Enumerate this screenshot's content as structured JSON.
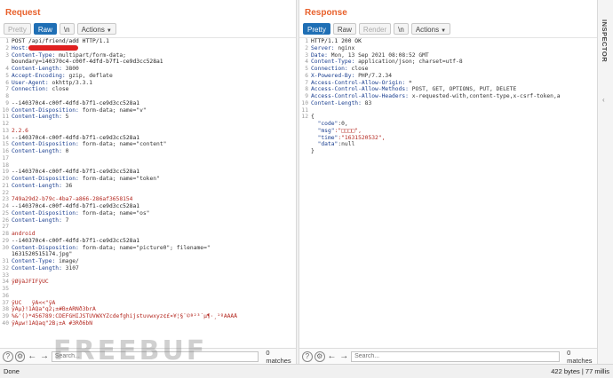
{
  "request": {
    "title": "Request",
    "tabs": [
      {
        "label": "Pretty",
        "state": "disabled"
      },
      {
        "label": "Raw",
        "state": "active"
      },
      {
        "label": "\\n",
        "state": "normal"
      },
      {
        "label": "Actions",
        "state": "normal"
      }
    ],
    "lines": [
      {
        "n": "1",
        "k": "",
        "v": "POST /api/friend/add HTTP/1.1",
        "style": "plain"
      },
      {
        "n": "2",
        "k": "Host:",
        "v": "",
        "style": "redact"
      },
      {
        "n": "3",
        "k": "Content-Type:",
        "v": " multipart/form-data;",
        "style": "kv"
      },
      {
        "n": "",
        "k": "",
        "v": "boundary=i40370c4-c00f-4dfd-b7f1-ce9d3cc528a1",
        "style": "plain"
      },
      {
        "n": "4",
        "k": "Content-Length:",
        "v": " 3800",
        "style": "kv"
      },
      {
        "n": "5",
        "k": "Accept-Encoding:",
        "v": " gzip, deflate",
        "style": "kv"
      },
      {
        "n": "6",
        "k": "User-Agent:",
        "v": " okhttp/3.3.1",
        "style": "kv"
      },
      {
        "n": "7",
        "k": "Connection:",
        "v": " close",
        "style": "kv"
      },
      {
        "n": "8",
        "k": "",
        "v": "",
        "style": "plain"
      },
      {
        "n": "9",
        "k": "",
        "v": "--i40370c4-c00f-4dfd-b7f1-ce9d3cc528a1",
        "style": "plain"
      },
      {
        "n": "10",
        "k": "Content-Disposition:",
        "v": " form-data; name=\"v\"",
        "style": "kv"
      },
      {
        "n": "11",
        "k": "Content-Length:",
        "v": " 5",
        "style": "kv"
      },
      {
        "n": "12",
        "k": "",
        "v": "",
        "style": "plain"
      },
      {
        "n": "13",
        "k": "",
        "v": "2.2.6",
        "style": "red"
      },
      {
        "n": "14",
        "k": "",
        "v": "--i40370c4-c00f-4dfd-b7f1-ce9d3cc528a1",
        "style": "plain"
      },
      {
        "n": "15",
        "k": "Content-Disposition:",
        "v": " form-data; name=\"content\"",
        "style": "kv"
      },
      {
        "n": "16",
        "k": "Content-Length:",
        "v": " 0",
        "style": "kv"
      },
      {
        "n": "17",
        "k": "",
        "v": "",
        "style": "plain"
      },
      {
        "n": "18",
        "k": "",
        "v": "",
        "style": "plain"
      },
      {
        "n": "19",
        "k": "",
        "v": "--i40370c4-c00f-4dfd-b7f1-ce9d3cc528a1",
        "style": "plain"
      },
      {
        "n": "20",
        "k": "Content-Disposition:",
        "v": " form-data; name=\"token\"",
        "style": "kv"
      },
      {
        "n": "21",
        "k": "Content-Length:",
        "v": " 36",
        "style": "kv"
      },
      {
        "n": "22",
        "k": "",
        "v": "",
        "style": "plain"
      },
      {
        "n": "23",
        "k": "",
        "v": "749a29d2-b79c-4ba7-a866-286af3658154",
        "style": "red"
      },
      {
        "n": "24",
        "k": "",
        "v": "--i40370c4-c00f-4dfd-b7f1-ce9d3cc528a1",
        "style": "plain"
      },
      {
        "n": "25",
        "k": "Content-Disposition:",
        "v": " form-data; name=\"os\"",
        "style": "kv"
      },
      {
        "n": "26",
        "k": "Content-Length:",
        "v": " 7",
        "style": "kv"
      },
      {
        "n": "27",
        "k": "",
        "v": "",
        "style": "plain"
      },
      {
        "n": "28",
        "k": "",
        "v": "android",
        "style": "red"
      },
      {
        "n": "29",
        "k": "",
        "v": "--i40370c4-c00f-4dfd-b7f1-ce9d3cc528a1",
        "style": "plain"
      },
      {
        "n": "30",
        "k": "Content-Disposition:",
        "v": " form-data; name=\"picture0\"; filename=\"",
        "style": "kv"
      },
      {
        "n": "",
        "k": "",
        "v": "1631520515174.jpg\"",
        "style": "plain"
      },
      {
        "n": "31",
        "k": "Content-Type:",
        "v": " image/",
        "style": "kv"
      },
      {
        "n": "32",
        "k": "Content-Length:",
        "v": " 3107",
        "style": "kv"
      },
      {
        "n": "33",
        "k": "",
        "v": "",
        "style": "plain"
      },
      {
        "n": "34",
        "k": "",
        "v": "ÿØÿàJFIFÿÛC",
        "style": "red"
      },
      {
        "n": "35",
        "k": "",
        "v": "",
        "style": "plain"
      },
      {
        "n": "36",
        "k": "",
        "v": "",
        "style": "plain"
      },
      {
        "n": "37",
        "k": "",
        "v": "ÿÛC   ÿÄ<<\"ÿÄ",
        "style": "red"
      },
      {
        "n": "38",
        "k": "",
        "v": "ÿÄµ}!1AQa\"q2¡±#B±ÁRÑð3brÂ",
        "style": "red"
      },
      {
        "n": "39",
        "k": "",
        "v": "%&'()*456789:CDEFGHIJSTUVWXYZcdefghijstuvwxyz¢£¤¥¦§¨©ª²³´µ¶·¸¹ºÂÃÄÅ",
        "style": "red"
      },
      {
        "n": "40",
        "k": "",
        "v": "ÿÄµw!1AQaq\"2B¡±Á #3Rð6bÑ",
        "style": "red"
      }
    ],
    "search_placeholder": "Search...",
    "match_count": "0 matches"
  },
  "response": {
    "title": "Response",
    "tabs": [
      {
        "label": "Pretty",
        "state": "active"
      },
      {
        "label": "Raw",
        "state": "normal"
      },
      {
        "label": "Render",
        "state": "disabled"
      },
      {
        "label": "\\n",
        "state": "normal"
      },
      {
        "label": "Actions",
        "state": "normal"
      }
    ],
    "lines": [
      {
        "n": "1",
        "k": "",
        "v": "HTTP/1.1 200 OK",
        "style": "plain"
      },
      {
        "n": "2",
        "k": "Server:",
        "v": " nginx",
        "style": "kv"
      },
      {
        "n": "3",
        "k": "Date:",
        "v": " Mon, 13 Sep 2021 08:08:52 GMT",
        "style": "kv"
      },
      {
        "n": "4",
        "k": "Content-Type:",
        "v": " application/json; charset=utf-8",
        "style": "kv"
      },
      {
        "n": "5",
        "k": "Connection:",
        "v": " close",
        "style": "kv"
      },
      {
        "n": "6",
        "k": "X-Powered-By:",
        "v": " PHP/7.2.34",
        "style": "kv"
      },
      {
        "n": "7",
        "k": "Access-Control-Allow-Origin:",
        "v": " *",
        "style": "kv"
      },
      {
        "n": "8",
        "k": "Access-Control-Allow-Methods:",
        "v": " POST, GET, OPTIONS, PUT, DELETE",
        "style": "kv"
      },
      {
        "n": "9",
        "k": "Access-Control-Allow-Headers:",
        "v": " x-requested-with,content-type,x-csrf-token,a",
        "style": "kv"
      },
      {
        "n": "10",
        "k": "Content-Length:",
        "v": " 83",
        "style": "kv"
      },
      {
        "n": "11",
        "k": "",
        "v": "",
        "style": "plain"
      },
      {
        "n": "12",
        "k": "",
        "v": "{",
        "style": "plain"
      },
      {
        "n": "",
        "k": "  \"code\"",
        "v": ":0,",
        "style": "json"
      },
      {
        "n": "",
        "k": "  \"msg\"",
        "v": ":\"□□□□\",",
        "style": "jsonstr"
      },
      {
        "n": "",
        "k": "  \"time\"",
        "v": ":\"1631520532\",",
        "style": "jsonstr"
      },
      {
        "n": "",
        "k": "  \"data\"",
        "v": ":null",
        "style": "json"
      },
      {
        "n": "",
        "k": "",
        "v": "}",
        "style": "plain"
      }
    ],
    "search_placeholder": "Search...",
    "match_count": "0 matches"
  },
  "inspector": {
    "label": "INSPECTOR"
  },
  "status": {
    "left": "Done",
    "right": "422 bytes | 77 millis"
  },
  "watermark": "FREEBUF",
  "colors": {
    "accent": "#e8612c",
    "active_tab": "#1f6fb5",
    "key": "#1a3e8f",
    "value_red": "#b3261e",
    "redaction": "#e02020"
  }
}
